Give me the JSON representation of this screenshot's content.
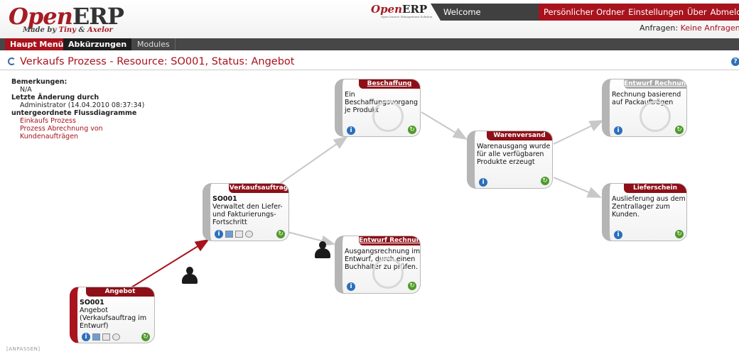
{
  "brand": {
    "logo_open": "Open",
    "logo_erp": "ERP",
    "logo_made_by": "Made by ",
    "logo_tiny": "Tiny",
    "logo_and": " & ",
    "logo_axelor": "Axelor",
    "small_logo_open": "Open",
    "small_logo_erp": "ERP",
    "small_logo_tagline": "Open Source Management Solution"
  },
  "header": {
    "welcome": "Welcome Administrator",
    "links": [
      "Persönlicher Ordner",
      "Einstellungen",
      "Über",
      "Abmeldung"
    ],
    "requests_label": "Anfragen:",
    "requests_value": "Keine Anfragen"
  },
  "menu": {
    "main": "Haupt Menü",
    "shortcuts": "Abkürzungen",
    "modules": "Modules"
  },
  "page": {
    "title": "Verkaufs Prozess - Resource: SO001, Status: Angebot",
    "help_glyph": "?"
  },
  "info": {
    "remarks_label": "Bemerkungen:",
    "remarks_value": "N/A",
    "last_change_label": "Letzte Änderung durch",
    "last_change_value": "Administrator (14.04.2010 08:37:34)",
    "subflows_label": "untergeordnete Flussdiagramme",
    "subflow_1": "Einkaufs Prozess",
    "subflow_2": "Prozess Abrechnung von Kundenaufträgen"
  },
  "nodes": {
    "angebot": {
      "title": "Angebot",
      "code": "SO001",
      "text": "Angebot (Verkaufsauftrag im Entwurf)"
    },
    "verkaufsauftrag": {
      "title": "Verkaufsauftrag",
      "code": "SO001",
      "text": "Verwaltet den Liefer- und Fakturierungs-Fortschritt"
    },
    "beschaffung": {
      "title": "Beschaffung",
      "text": "Ein Beschaffungsvorgang je Produkt"
    },
    "entwurf_rechnung_1": {
      "title": "Entwurf Rechnung",
      "text": "Ausgangsrechnung im Entwurf, durch einen Buchhalter zu prüfen."
    },
    "warenversand": {
      "title": "Warenversand",
      "text": "Warenausgang wurde für alle verfügbaren Produkte erzeugt"
    },
    "entwurf_rechnung_2": {
      "title": "Entwurf Rechnung",
      "text": "Rechnung basierend auf Packaufträgen"
    },
    "lieferschein": {
      "title": "Lieferschein",
      "text": "Auslieferung aus dem Zentrallager zum Kunden."
    }
  },
  "icons": {
    "info_glyph": "i",
    "go_glyph": "↻"
  },
  "colors": {
    "brand_red": "#a8131d",
    "active_arrow": "#a8131d",
    "inactive_arrow": "#c8c8c8",
    "info_blue": "#2c6fbd",
    "go_green": "#4f9a2b"
  },
  "footer": {
    "customize": "[ANPASSEN]"
  }
}
